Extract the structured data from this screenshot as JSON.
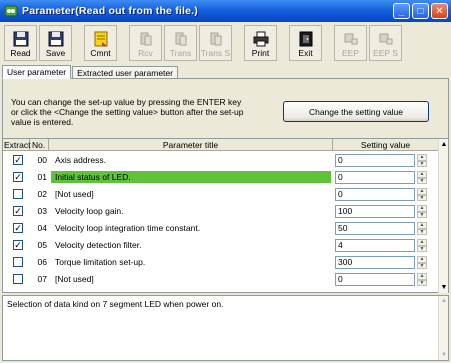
{
  "window": {
    "title": "Parameter(Read out from the file.)"
  },
  "toolbar": {
    "buttons": [
      {
        "label": "Read",
        "icon": "floppy-disk-icon",
        "enabled": true
      },
      {
        "label": "Save",
        "icon": "save-icon",
        "enabled": true
      },
      {
        "label": "Cmnt",
        "icon": "comment-icon",
        "enabled": true
      },
      {
        "label": "Rcv",
        "icon": "receive-icon",
        "enabled": false
      },
      {
        "label": "Trans",
        "icon": "transmit-icon",
        "enabled": false
      },
      {
        "label": "Trans S",
        "icon": "transmit-selected-icon",
        "enabled": false
      },
      {
        "label": "Print",
        "icon": "printer-icon",
        "enabled": true
      },
      {
        "label": "Exit",
        "icon": "exit-icon",
        "enabled": true
      },
      {
        "label": "EEP",
        "icon": "eeprom-icon",
        "enabled": false
      },
      {
        "label": "EEP S",
        "icon": "eeprom-selected-icon",
        "enabled": false
      }
    ]
  },
  "tabs": [
    {
      "label": "User parameter",
      "active": true
    },
    {
      "label": "Extracted user parameter",
      "active": false
    }
  ],
  "info": {
    "line1": "You can change the set-up value by pressing the ENTER key",
    "line2": "or click the <Change the setting value> button after the set-up",
    "line3": "value is entered."
  },
  "change_button": {
    "label": "Change the setting value"
  },
  "table": {
    "headers": {
      "extract": "Extract",
      "no": "No.",
      "title": "Parameter title",
      "value": "Setting value"
    },
    "rows": [
      {
        "checked": true,
        "no": "00",
        "title": "Axis address.",
        "value": "0",
        "selected": false
      },
      {
        "checked": true,
        "no": "01",
        "title": "Initial status of LED.",
        "value": "0",
        "selected": true
      },
      {
        "checked": false,
        "no": "02",
        "title": "[Not used]",
        "value": "0",
        "selected": false
      },
      {
        "checked": true,
        "no": "03",
        "title": "Velocity loop gain.",
        "value": "100",
        "selected": false
      },
      {
        "checked": true,
        "no": "04",
        "title": "Velocity loop integration time constant.",
        "value": "50",
        "selected": false
      },
      {
        "checked": true,
        "no": "05",
        "title": "Velocity detection filter.",
        "value": "4",
        "selected": false
      },
      {
        "checked": false,
        "no": "06",
        "title": "Torque limitation set-up.",
        "value": "300",
        "selected": false
      },
      {
        "checked": false,
        "no": "07",
        "title": "[Not used]",
        "value": "0",
        "selected": false
      }
    ]
  },
  "description": {
    "text": "Selection of data kind on 7 segment LED when power on."
  },
  "colors": {
    "titlebar": "#0b4fd0",
    "selected_row": "#5fc23b"
  }
}
